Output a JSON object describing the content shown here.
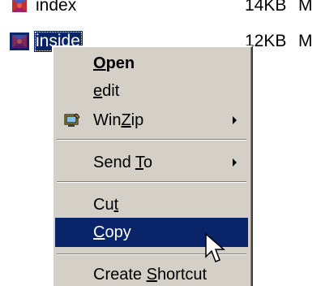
{
  "files": [
    {
      "name": "index",
      "size": "14KB",
      "type": "M",
      "icon": "html-file-icon",
      "selected": false
    },
    {
      "name": "inside",
      "size": "12KB",
      "type": "M",
      "icon": "html-file-icon",
      "selected": true
    }
  ],
  "context_menu": {
    "items": [
      {
        "pre": "",
        "acc": "O",
        "post": "pen",
        "bold": true,
        "submenu": false
      },
      {
        "pre": "",
        "acc": "e",
        "post": "dit",
        "bold": false,
        "submenu": false
      },
      {
        "pre": "Win",
        "acc": "Z",
        "post": "ip",
        "bold": false,
        "submenu": true,
        "icon": "winzip-icon"
      },
      {
        "pre": "Send ",
        "acc": "T",
        "post": "o",
        "bold": false,
        "submenu": true
      },
      {
        "pre": "Cu",
        "acc": "t",
        "post": "",
        "bold": false,
        "submenu": false
      },
      {
        "pre": "",
        "acc": "C",
        "post": "opy",
        "bold": false,
        "submenu": false,
        "highlighted": true
      },
      {
        "pre": "Create ",
        "acc": "S",
        "post": "hortcut",
        "bold": false,
        "submenu": false
      }
    ]
  },
  "colors": {
    "menu_background": "#d4d0c8",
    "highlight": "#0a246a",
    "highlight_text": "#ffffff"
  }
}
